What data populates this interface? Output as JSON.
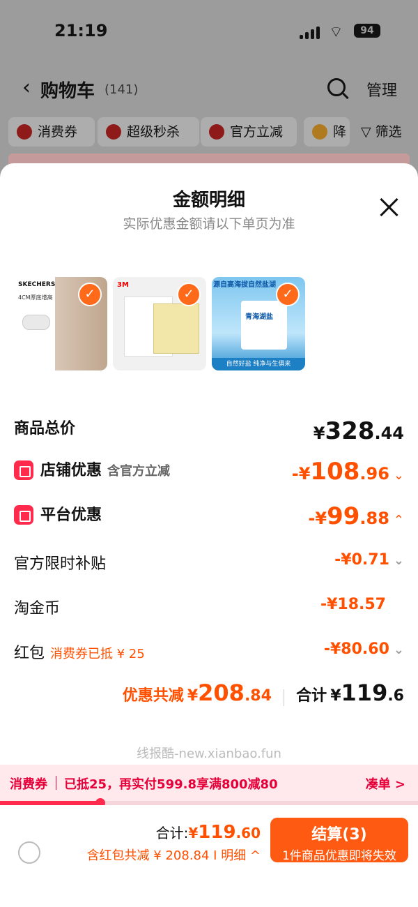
{
  "status": {
    "time": "21:19",
    "battery": "94"
  },
  "cart": {
    "title": "购物车",
    "count": "(141)",
    "manage": "管理"
  },
  "chips": [
    "消费券",
    "超级秒杀",
    "官方立减",
    "降"
  ],
  "filter": "筛选",
  "sheet": {
    "title": "金额明细",
    "subtitle": "实际优惠金额请以下单页为准",
    "products": [
      {
        "name": "SKECHERS",
        "caption": "4CM厚底增高",
        "checked": true
      },
      {
        "name": "3M",
        "caption": "",
        "checked": true
      },
      {
        "name": "源自高海拔自然盐湖",
        "caption": "自然好盐  纯净与生俱来",
        "label": "青海湖盐",
        "checked": true
      }
    ],
    "total": {
      "label": "商品总价",
      "yen": "¥",
      "int": "328",
      "dec": ".44"
    },
    "shop": {
      "label": "店铺优惠",
      "note": "含官方立减",
      "sign": "-¥",
      "int": "108",
      "dec": ".96"
    },
    "platform": {
      "label": "平台优惠",
      "sign": "-¥",
      "int": "99",
      "dec": ".88"
    },
    "subsidy": {
      "label": "官方限时补贴",
      "sign": "-¥",
      "int": "0",
      "dec": ".71"
    },
    "coin": {
      "label": "淘金币",
      "sign": "-¥",
      "int": "18",
      "dec": ".57"
    },
    "redpacket": {
      "label": "红包",
      "note": "消费券已抵 ¥ 25",
      "sign": "-¥",
      "int": "80",
      "dec": ".60"
    },
    "summary": {
      "discount_label": "优惠共减",
      "yen": "¥",
      "discount_int": "208",
      "discount_dec": ".84",
      "total_label": "合计",
      "total_yen": "¥",
      "total_int": "119",
      "total_dec": ".6"
    }
  },
  "watermark": "线报酷-new.xianbao.fun",
  "promo": {
    "tag": "消费券",
    "text": "已抵25，再实付599.8享满800减80",
    "action": "凑单 >",
    "progress": 0.24
  },
  "bottom": {
    "total_label": "合计:",
    "total_yen": "¥",
    "total_int": "119",
    "total_dec": ".60",
    "discount": "含红包共减 ¥ 208.84 I 明细 ^",
    "pay_label": "结算(3)",
    "pay_note": "1件商品优惠即将失效"
  },
  "colors": {
    "accent": "#ff5000",
    "red": "#ff2a4c",
    "pay": "#ff5a12"
  }
}
